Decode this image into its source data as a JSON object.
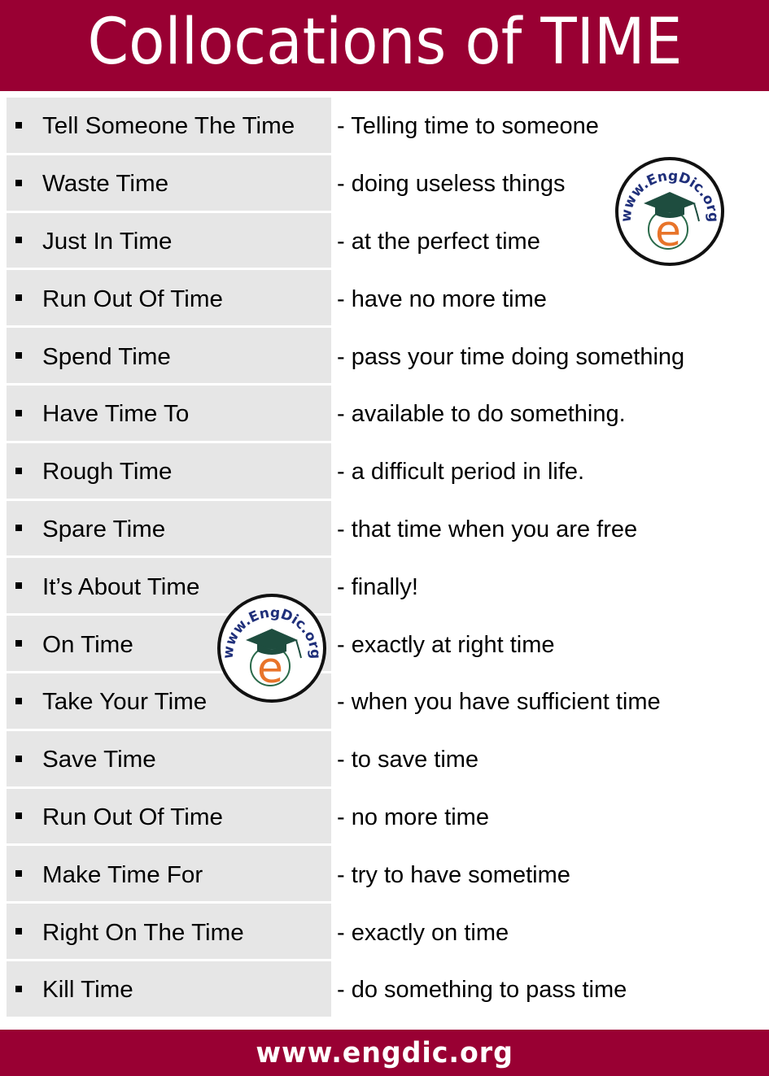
{
  "header": {
    "title": "Collocations of TIME"
  },
  "colors": {
    "brand": "#990033",
    "term_cell_bg": "#e6e6e6",
    "logo_text": "#1f2f7a",
    "logo_cap": "#1e4d3f",
    "logo_e": "#e8742a"
  },
  "logo": {
    "text": "www.EngDic.org",
    "letter": "e"
  },
  "collocations": [
    {
      "term": "Tell Someone The Time",
      "meaning": "- Telling time to someone"
    },
    {
      "term": "Waste Time",
      "meaning": "- doing useless things"
    },
    {
      "term": "Just In Time",
      "meaning": "- at the perfect time"
    },
    {
      "term": "Run Out Of Time",
      "meaning": "- have no more time"
    },
    {
      "term": "Spend Time",
      "meaning": "- pass your time doing something"
    },
    {
      "term": "Have Time To",
      "meaning": "- available to do something."
    },
    {
      "term": "Rough Time",
      "meaning": "- a difficult period in life."
    },
    {
      "term": "Spare Time",
      "meaning": "- that time when you are free"
    },
    {
      "term": "It’s About Time",
      "meaning": "- finally!"
    },
    {
      "term": "On Time",
      "meaning": "- exactly at right time"
    },
    {
      "term": "Take Your Time",
      "meaning": "- when you have sufficient time"
    },
    {
      "term": "Save Time",
      "meaning": "- to save time"
    },
    {
      "term": "Run Out Of Time",
      "meaning": "- no more time"
    },
    {
      "term": "Make Time For",
      "meaning": "- try to have sometime"
    },
    {
      "term": "Right On The Time",
      "meaning": "- exactly on time"
    },
    {
      "term": "Kill Time",
      "meaning": "- do something to pass time"
    }
  ],
  "footer": {
    "url": "www.engdic.org"
  }
}
